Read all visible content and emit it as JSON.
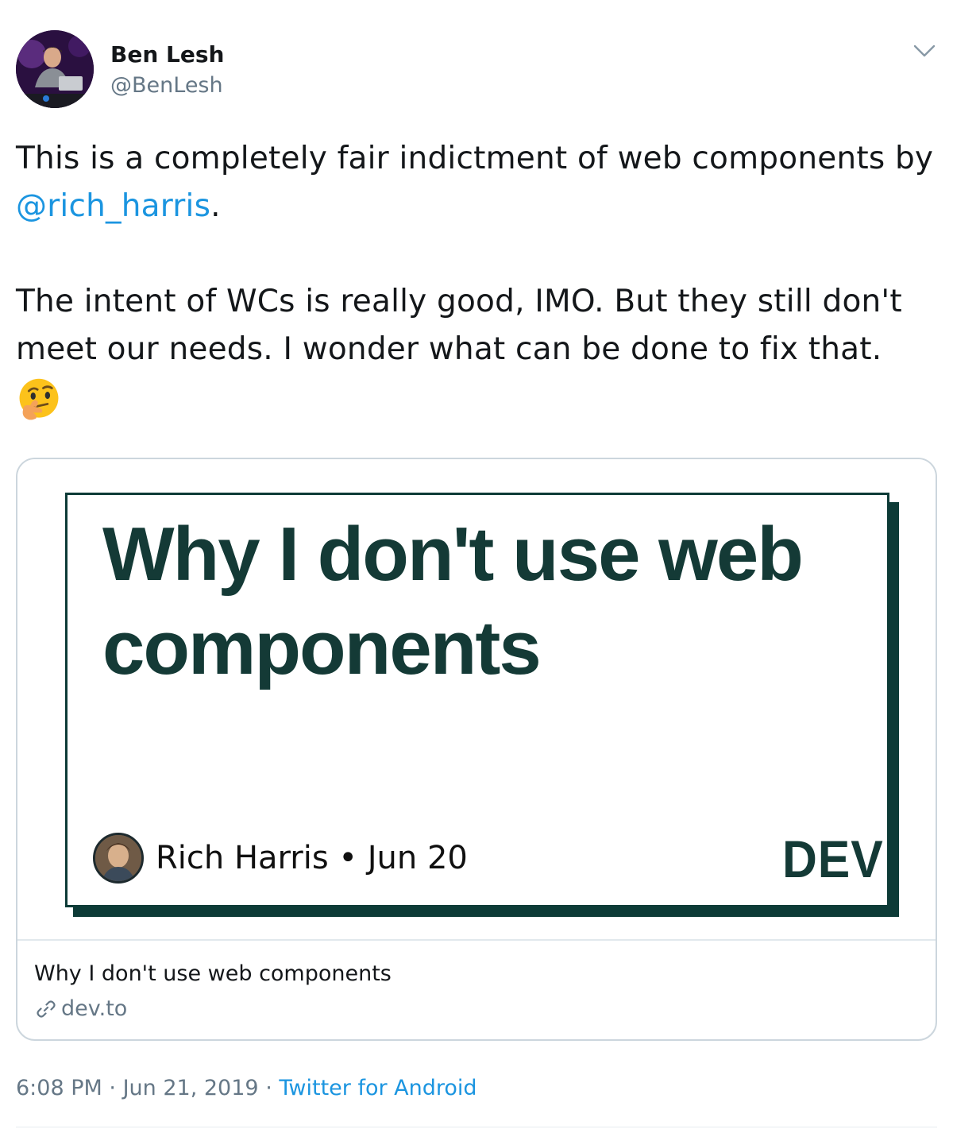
{
  "author": {
    "display_name": "Ben Lesh",
    "handle": "@BenLesh",
    "avatar_icon": "profile-photo"
  },
  "menu": {
    "icon": "chevron-down-icon"
  },
  "tweet": {
    "line1_pre": "This is a completely fair indictment of web components by ",
    "mention": "@rich_harris",
    "line1_post": ".",
    "line2": "The intent of WCs is really good, IMO. But they still don't meet our needs. I wonder what can be done to fix that.",
    "emoji": "thinking-face-emoji"
  },
  "card": {
    "image": {
      "headline": "Why I don't use web components",
      "author": "Rich Harris",
      "separator": "•",
      "date": "Jun 20",
      "brand": "DEV"
    },
    "title": "Why I don't use web components",
    "domain": "dev.to",
    "domain_icon": "link-icon"
  },
  "meta": {
    "time": "6:08 PM",
    "dot": "·",
    "date": "Jun 21, 2019",
    "source": "Twitter for Android"
  },
  "colors": {
    "link": "#1b95e0",
    "secondary_text": "#657786",
    "dev_green": "#143a36",
    "border": "#ccd6dd"
  }
}
